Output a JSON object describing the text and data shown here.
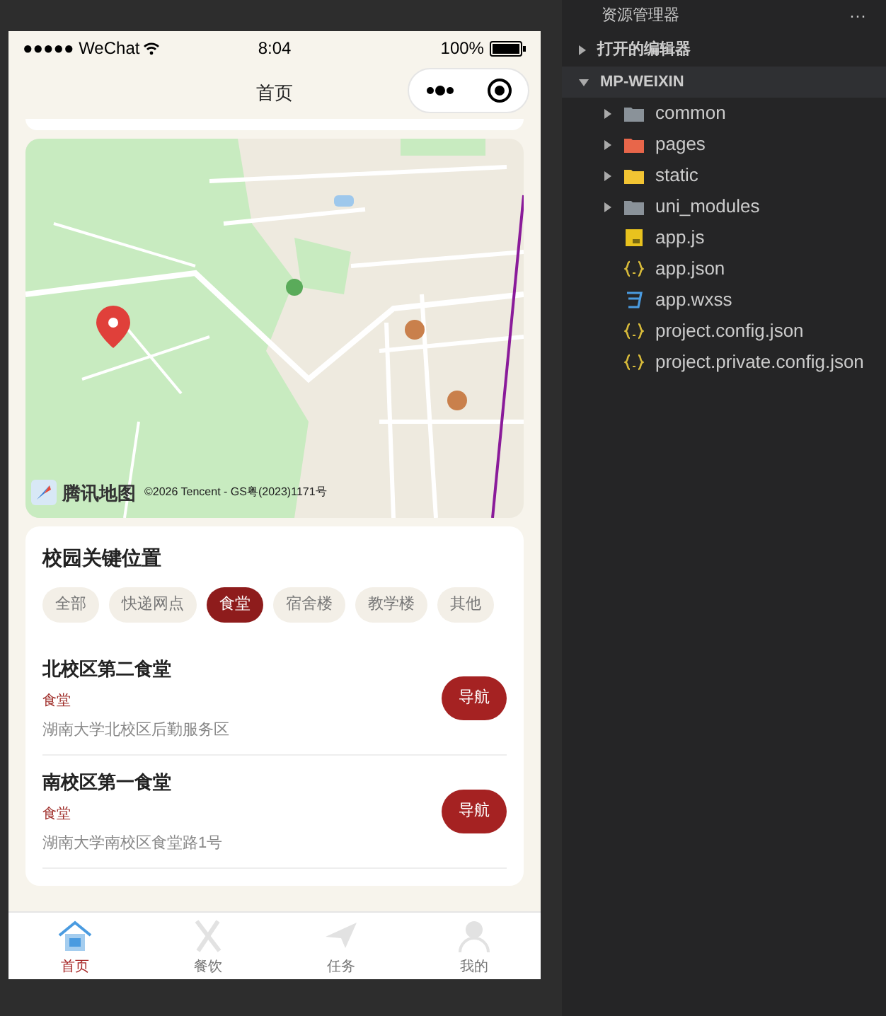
{
  "phone": {
    "status_bar": {
      "carrier": "●●●●● WeChat",
      "time": "8:04",
      "battery": "100%"
    },
    "nav_bar": {
      "title": "首页"
    },
    "map": {
      "kind": "picture",
      "logo_text": "腾讯地图",
      "copyright": "©2026 Tencent - GS粤(2023)1171号"
    },
    "locations": {
      "title": "校园关键位置",
      "filters": [
        {
          "label": "全部",
          "selected": false
        },
        {
          "label": "快递网点",
          "selected": false
        },
        {
          "label": "食堂",
          "selected": true
        },
        {
          "label": "宿舍楼",
          "selected": false
        },
        {
          "label": "教学楼",
          "selected": false
        },
        {
          "label": "其他",
          "selected": false
        }
      ],
      "items": [
        {
          "name": "北校区第二食堂",
          "category": "食堂",
          "address": "湖南大学北校区后勤服务区",
          "button": "导航"
        },
        {
          "name": "南校区第一食堂",
          "category": "食堂",
          "address": "湖南大学南校区食堂路1号",
          "button": "导航"
        }
      ]
    },
    "tab_bar": [
      {
        "label": "首页",
        "kind": "home",
        "selected": true
      },
      {
        "label": "餐饮",
        "kind": "food",
        "selected": false
      },
      {
        "label": "任务",
        "kind": "task",
        "selected": false
      },
      {
        "label": "我的",
        "kind": "profile",
        "selected": false
      }
    ]
  },
  "explorer": {
    "title": "资源管理器",
    "more": "···",
    "sections": [
      {
        "label": "打开的编辑器",
        "expanded": false
      },
      {
        "label": "MP-WEIXIN",
        "expanded": true,
        "children": [
          {
            "label": "common",
            "kind": "folder",
            "color": "#8a9299",
            "expanded": false
          },
          {
            "label": "pages",
            "kind": "folder",
            "color": "#e8664a",
            "expanded": false
          },
          {
            "label": "static",
            "kind": "folder",
            "color": "#f2c433",
            "expanded": false
          },
          {
            "label": "uni_modules",
            "kind": "folder",
            "color": "#8a9299",
            "expanded": false
          },
          {
            "label": "app.js",
            "kind": "js"
          },
          {
            "label": "app.json",
            "kind": "json"
          },
          {
            "label": "app.wxss",
            "kind": "wxss"
          },
          {
            "label": "project.config.json",
            "kind": "json"
          },
          {
            "label": "project.private.config.json",
            "kind": "json"
          }
        ]
      }
    ]
  }
}
